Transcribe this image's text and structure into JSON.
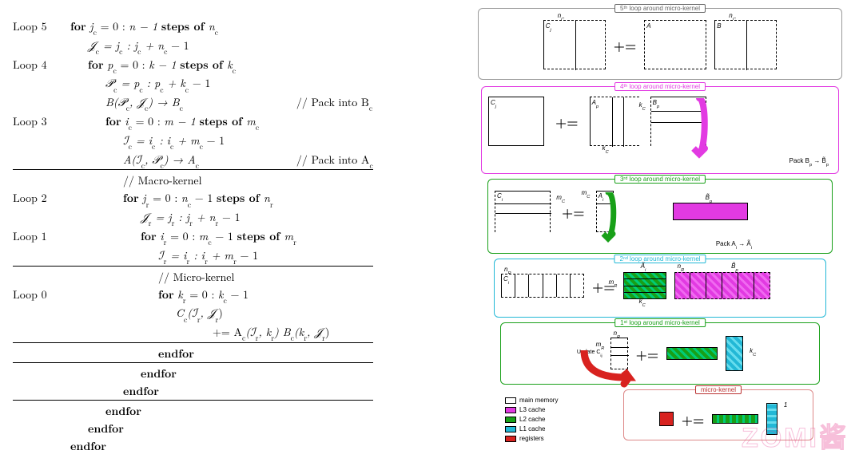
{
  "algo": {
    "loop5": {
      "label": "Loop 5",
      "for": "for",
      "var": "j",
      "sub": "c",
      "rangeA": " = 0 : ",
      "rangeB": "n − 1",
      "steps": " steps of ",
      "step": "n",
      "stepSub": "c"
    },
    "loop5b": {
      "text": "𝒥",
      "sub": "c",
      "eq": " = j",
      "sub2": "c",
      "text2": " : j",
      "sub3": "c",
      "text3": " + n",
      "sub4": "c",
      "text4": " − 1"
    },
    "loop4": {
      "label": "Loop 4",
      "for": "for",
      "var": "p",
      "sub": "c",
      "rangeA": " = 0 : ",
      "rangeB": "k − 1",
      "steps": " steps of ",
      "step": "k",
      "stepSub": "c"
    },
    "loop4b": {
      "text": "𝒫",
      "sub": "c",
      "eq": " = p",
      "sub2": "c",
      "text2": " : p",
      "sub3": "c",
      "text3": " + k",
      "sub4": "c",
      "text4": " − 1"
    },
    "packB": {
      "body": "B(𝒫",
      "s1": "c",
      "body2": ", 𝒥",
      "s2": "c",
      "body3": ") → B",
      "s3": "c",
      "comment": "// Pack into B",
      "csub": "c"
    },
    "loop3": {
      "label": "Loop 3",
      "for": "for",
      "var": "i",
      "sub": "c",
      "rangeA": " = 0 : ",
      "rangeB": "m − 1",
      "steps": " steps of ",
      "step": "m",
      "stepSub": "c"
    },
    "loop3b": {
      "text": "ℐ",
      "sub": "c",
      "eq": " = i",
      "sub2": "c",
      "text2": " : i",
      "sub3": "c",
      "text3": " + m",
      "sub4": "c",
      "text4": " − 1"
    },
    "packA": {
      "body": "A(ℐ",
      "s1": "c",
      "body2": ", 𝒫",
      "s2": "c",
      "body3": ") → A",
      "s3": "c",
      "comment": "// Pack into A",
      "csub": "c"
    },
    "macro": "// Macro-kernel",
    "loop2": {
      "label": "Loop 2",
      "for": "for",
      "var": "j",
      "sub": "r",
      "rangeA": " = 0 : ",
      "rangeB": "n",
      "rangeBsub": "c",
      "rangeC": " − 1",
      "steps": " steps of ",
      "step": "n",
      "stepSub": "r"
    },
    "loop2b": {
      "text": "𝒥",
      "sub": "r",
      "eq": " = j",
      "sub2": "r",
      "text2": " : j",
      "sub3": "r",
      "text3": " + n",
      "sub4": "r",
      "text4": " − 1"
    },
    "loop1": {
      "label": "Loop 1",
      "for": "for",
      "var": "i",
      "sub": "r",
      "rangeA": " = 0 : ",
      "rangeB": "m",
      "rangeBsub": "c",
      "rangeC": " − 1",
      "steps": " steps of ",
      "step": "m",
      "stepSub": "r"
    },
    "loop1b": {
      "text": "ℐ",
      "sub": "r",
      "eq": " = i",
      "sub2": "r",
      "text2": " : i",
      "sub3": "r",
      "text3": " + m",
      "sub4": "r",
      "text4": " − 1"
    },
    "micro": "// Micro-kernel",
    "loop0": {
      "label": "Loop 0",
      "for": "for",
      "var": "k",
      "sub": "r",
      "rangeA": " = 0 : ",
      "rangeB": "k",
      "rangeBsub": "c",
      "rangeC": " − 1"
    },
    "core1": {
      "t": "C",
      "s": "c",
      "p": "(ℐ",
      "s1": "r",
      "p2": ", 𝒥",
      "s2": "r",
      "p3": ")"
    },
    "core2": {
      "pre": " += A",
      "s": "c",
      "p": "(ℐ",
      "s1": "r",
      "p2": ", k",
      "s2": "r",
      "p3": ")   B",
      "s3": "c",
      "p4": "(k",
      "s4": "r",
      "p5": ", 𝒥",
      "s5": "r",
      "p6": ")"
    },
    "end": "endfor"
  },
  "diagram": {
    "tier5": {
      "title": "5ᵗʰ loop around micro-kernel",
      "nC": "n",
      "nCs": "C",
      "Cj": "C",
      "Cjs": "j",
      "A": "A",
      "B": "B",
      "plus": "+="
    },
    "tier4": {
      "title": "4ᵗʰ loop around micro-kernel",
      "Cj": "C",
      "Cjs": "j",
      "Ap": "A",
      "Aps": "p",
      "kc": "k",
      "kcs": "C",
      "Bp": "B",
      "Bps": "p",
      "plus": "+=",
      "pack": "Pack B",
      "packS1": "p",
      "pack2": " → B̃",
      "packS2": "p"
    },
    "tier3": {
      "title": "3ʳᵈ loop around micro-kernel",
      "Ci": "C",
      "Cis": "i",
      "mc": "m",
      "mcs": "C",
      "Ai": "A",
      "Ais": "i",
      "plus": "+=",
      "Btilde": "B̃",
      "BtildeS": "p",
      "pack": "Pack A",
      "packS1": "i",
      "pack2": " → Ã",
      "packS2": "i"
    },
    "tier2": {
      "title": "2ⁿᵈ loop around micro-kernel",
      "nR": "n",
      "nRs": "R",
      "Ci": "C",
      "Cis": "i",
      "At": "Ã",
      "Ats": "i",
      "mR": "m",
      "mRs": "R",
      "Bt": "B̃",
      "Bts": "p",
      "kc": "k",
      "kcs": "C",
      "plus": "+="
    },
    "tier1": {
      "title": "1ˢᵗ loop around micro-kernel",
      "update": "Update C",
      "updateS": "ij",
      "plus": "+=",
      "kc": "k",
      "kcs": "C",
      "mR": "m",
      "mRs": "R",
      "nR": "n",
      "nRs": "R"
    },
    "tier0": {
      "title": "micro-kernel",
      "plus": "+=",
      "one": "1"
    },
    "legend": {
      "mm": "main memory",
      "l3": "L3 cache",
      "l2": "L2 cache",
      "l1": "L1 cache",
      "reg": "registers"
    },
    "watermark": "ZOMI酱"
  }
}
